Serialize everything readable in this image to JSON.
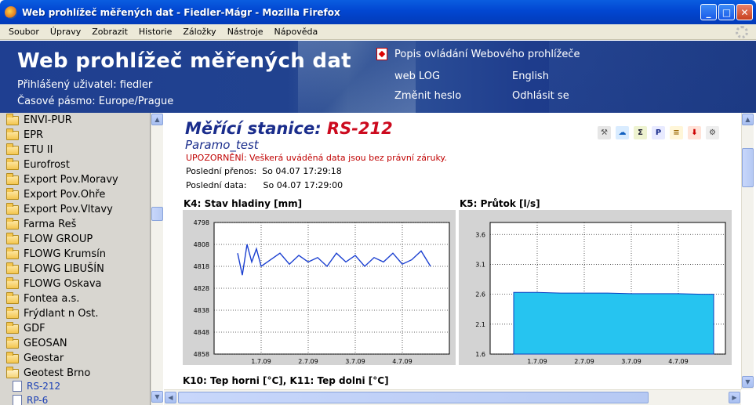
{
  "window": {
    "title": "Web prohlížeč měřených dat - Fiedler-Mágr - Mozilla Firefox",
    "btn_min": "_",
    "btn_max": "□",
    "btn_close": "✕"
  },
  "menu": [
    "Soubor",
    "Úpravy",
    "Zobrazit",
    "Historie",
    "Záložky",
    "Nástroje",
    "Nápověda"
  ],
  "header": {
    "title": "Web prohlížeč měřených dat",
    "user": "Přihlášený uživatel: fiedler",
    "timezone": "Časové pásmo: Europe/Prague",
    "links": {
      "manual": "Popis ovládání Webového prohlížeče",
      "weblog": "web LOG",
      "english": "English",
      "password": "Změnit heslo",
      "logout": "Odhlásit se"
    }
  },
  "sidebar": {
    "items": [
      "ENVI-PUR",
      "EPR",
      "ETU II",
      "Eurofrost",
      "Export Pov.Moravy",
      "Export Pov.Ohře",
      "Export Pov.Vltavy",
      "Farma Reš",
      "FLOW GROUP",
      "FLOWG Krumsín",
      "FLOWG LIBUŠÍN",
      "FLOWG Oskava",
      "Fontea a.s.",
      "Frýdlant n Ost.",
      "GDF",
      "GEOSAN",
      "Geostar",
      "Geotest Brno"
    ],
    "sub_items": [
      "RS-212",
      "RP-6"
    ]
  },
  "station": {
    "label": "Měřící stanice:",
    "code": "RS-212",
    "name": "Paramo_test",
    "warning": "UPOZORNĚNÍ: Veškerá uváděná data jsou bez právní záruky.",
    "last_transfer_label": "Poslední přenos:",
    "last_transfer_value": "So 04.07 17:29:18",
    "last_data_label": "Poslední data:",
    "last_data_value": "So 04.07 17:29:00"
  },
  "toolbar_icons": [
    "wrench-icon",
    "cloud-export-icon",
    "sum-icon",
    "settings-person-icon",
    "report-icon",
    "pdf-download-icon",
    "gears-icon"
  ],
  "next_section": "K10: Tep horni [°C], K11: Tep dolni [°C]",
  "colors": {
    "header_bg": "#1f3f91",
    "line": "#1a3fd0",
    "area": "#26c4f0",
    "title_blue": "#1a2d8c",
    "title_red": "#cc0a1e"
  },
  "chart_data": [
    {
      "type": "line",
      "title": "K4: Stav hladiny [mm]",
      "xlabel": "",
      "ylabel": "",
      "x_ticks": [
        "1.7.09",
        "2.7.09",
        "3.7.09",
        "4.7.09"
      ],
      "y_ticks": [
        4798,
        4808,
        4818,
        4828,
        4838,
        4848,
        4858
      ],
      "ylim": [
        4858,
        4798
      ],
      "y_inverted": true,
      "grid": true,
      "series": [
        {
          "x": [
            0.5,
            0.6,
            0.7,
            0.8,
            0.9,
            1.0,
            1.2,
            1.4,
            1.6,
            1.8,
            2.0,
            2.2,
            2.4,
            2.6,
            2.8,
            3.0,
            3.2,
            3.4,
            3.6,
            3.8,
            4.0,
            4.2,
            4.4,
            4.6
          ],
          "y": [
            4812,
            4822,
            4808,
            4816,
            4810,
            4818,
            4815,
            4812,
            4817,
            4813,
            4816,
            4814,
            4818,
            4812,
            4816,
            4813,
            4818,
            4814,
            4816,
            4812,
            4817,
            4815,
            4811,
            4818
          ]
        }
      ]
    },
    {
      "type": "area",
      "title": "K5: Průtok [l/s]",
      "xlabel": "",
      "ylabel": "",
      "x_ticks": [
        "1.7.09",
        "2.7.09",
        "3.7.09",
        "4.7.09"
      ],
      "y_ticks": [
        1.6,
        2.1,
        2.6,
        3.1,
        3.6
      ],
      "ylim": [
        1.6,
        3.8
      ],
      "grid": true,
      "series": [
        {
          "x": [
            0.5,
            1.0,
            1.5,
            2.0,
            2.5,
            3.0,
            3.5,
            4.0,
            4.5,
            4.75
          ],
          "y": [
            2.63,
            2.63,
            2.62,
            2.62,
            2.62,
            2.61,
            2.61,
            2.61,
            2.6,
            2.6
          ]
        }
      ]
    }
  ]
}
